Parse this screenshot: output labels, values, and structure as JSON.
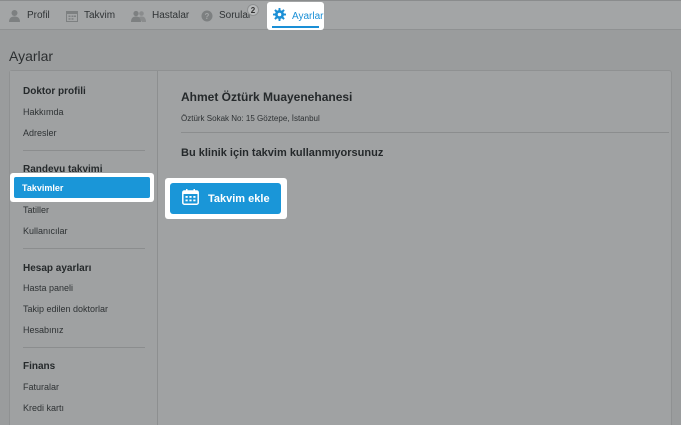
{
  "nav": {
    "items": [
      {
        "label": "Profil",
        "icon": "user-icon"
      },
      {
        "label": "Takvim",
        "icon": "calendar-icon"
      },
      {
        "label": "Hastalar",
        "icon": "users-icon"
      },
      {
        "label": "Sorular",
        "icon": "question-icon",
        "badge": "2"
      },
      {
        "label": "Ayarlar",
        "icon": "gear-icon",
        "active": true
      }
    ],
    "accent": "#1a8fd6"
  },
  "page": {
    "title": "Ayarlar"
  },
  "sidebar": {
    "sections": [
      {
        "title": "Doktor profili",
        "items": [
          "Hakkımda",
          "Adresler"
        ]
      },
      {
        "title": "Randevu takvimi",
        "items": [
          "Takvimler",
          "Tatiller",
          "Kullanıcılar"
        ],
        "active": "Takvimler"
      },
      {
        "title": "Hesap ayarları",
        "items": [
          "Hasta paneli",
          "Takip edilen doktorlar",
          "Hesabınız"
        ]
      },
      {
        "title": "Finans",
        "items": [
          "Faturalar",
          "Kredi kartı"
        ]
      }
    ]
  },
  "content": {
    "clinic_name": "Ahmet Öztürk Muayenehanesi",
    "address": "Öztürk Sokak No: 15 Göztepe, İstanbul",
    "notice": "Bu klinik için takvim kullanmıyorsunuz",
    "add_button": "Takvim ekle"
  }
}
